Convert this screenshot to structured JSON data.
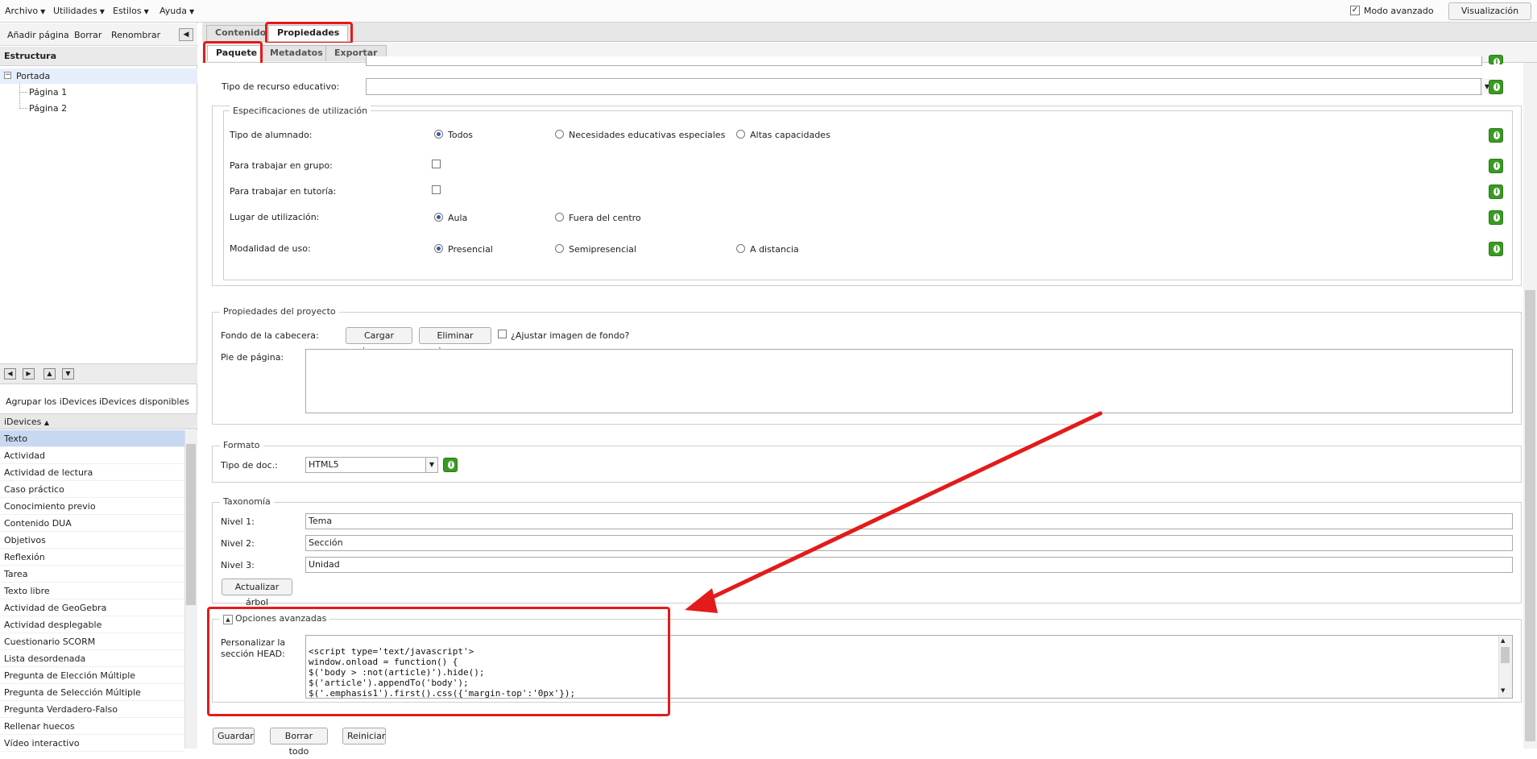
{
  "menubar": {
    "items": [
      "Archivo",
      "Utilidades",
      "Estilos",
      "Ayuda"
    ],
    "modo_avanzado": "Modo avanzado",
    "preview": "Visualización previa"
  },
  "left": {
    "toolbar": [
      "Añadir página",
      "Borrar",
      "Renombrar"
    ],
    "estructura": "Estructura",
    "tree": {
      "root": "Portada",
      "children": [
        "Página 1",
        "Página 2"
      ]
    },
    "idevice_tabs": [
      "Agrupar los iDevices",
      "iDevices disponibles"
    ],
    "idevices_header": "iDevices",
    "idevices": [
      "Texto",
      "Actividad",
      "Actividad de lectura",
      "Caso práctico",
      "Conocimiento previo",
      "Contenido DUA",
      "Objetivos",
      "Reflexión",
      "Tarea",
      "Texto libre",
      "Actividad de GeoGebra",
      "Actividad desplegable",
      "Cuestionario SCORM",
      "Lista desordenada",
      "Pregunta de Elección Múltiple",
      "Pregunta de Selección Múltiple",
      "Pregunta Verdadero-Falso",
      "Rellenar huecos",
      "Vídeo interactivo"
    ]
  },
  "tabs": {
    "contenido": "Contenido",
    "propiedades": "Propiedades"
  },
  "subtabs": {
    "paquete": "Paquete",
    "metadatos": "Metadatos",
    "exportar": "Exportar"
  },
  "form": {
    "tipo_recurso_label": "Tipo de recurso educativo:",
    "espec_legend": "Especificaciones de utilización",
    "tipo_alumnado": {
      "label": "Tipo de alumnado:",
      "options": [
        "Todos",
        "Necesidades educativas especiales",
        "Altas capacidades"
      ]
    },
    "grupo_label": "Para trabajar en grupo:",
    "tutoria_label": "Para trabajar en tutoría:",
    "lugar": {
      "label": "Lugar de utilización:",
      "options": [
        "Aula",
        "Fuera del centro"
      ]
    },
    "modalidad": {
      "label": "Modalidad de uso:",
      "options": [
        "Presencial",
        "Semipresencial",
        "A distancia"
      ]
    },
    "proyecto_legend": "Propiedades del proyecto",
    "fondo_label": "Fondo de la cabecera:",
    "cargar_imagen": "Cargar imagen",
    "eliminar_imagen": "Eliminar imagen",
    "ajustar": "¿Ajustar imagen de fondo?",
    "pie_label": "Pie de página:",
    "formato_legend": "Formato",
    "tipo_doc_label": "Tipo de doc.:",
    "tipo_doc_value": "HTML5",
    "taxonomia_legend": "Taxonomía",
    "nivel1_label": "Nivel 1:",
    "nivel1_value": "Tema",
    "nivel2_label": "Nivel 2:",
    "nivel2_value": "Sección",
    "nivel3_label": "Nivel 3:",
    "nivel3_value": "Unidad",
    "actualizar": "Actualizar árbol",
    "avanzadas_legend": "Opciones avanzadas",
    "head_label_1": "Personalizar la",
    "head_label_2": "sección HEAD:",
    "head_code": [
      "<script type='text/javascript'>",
      "window.onload = function() {",
      "$('body > :not(article)').hide();",
      "$('article').appendTo('body');",
      "$('.emphasis1').first().css({'margin-top':'0px'});"
    ]
  },
  "footer": {
    "guardar": "Guardar",
    "borrar_todo": "Borrar todo",
    "reiniciar": "Reiniciar"
  }
}
